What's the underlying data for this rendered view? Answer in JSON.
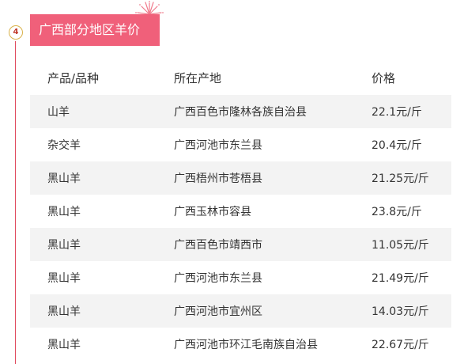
{
  "section": {
    "number": "4",
    "title": "广西部分地区羊价"
  },
  "colors": {
    "accent": "#f0607a",
    "timeline": "#e04b5f",
    "row_shade": "#f3f3f3"
  },
  "table": {
    "headers": [
      "产品/品种",
      "所在产地",
      "价格"
    ],
    "rows": [
      [
        "山羊",
        "广西百色市隆林各族自治县",
        "22.1元/斤"
      ],
      [
        "杂交羊",
        "广西河池市东兰县",
        "20.4元/斤"
      ],
      [
        "黑山羊",
        "广西梧州市苍梧县",
        "21.25元/斤"
      ],
      [
        "黑山羊",
        "广西玉林市容县",
        "23.8元/斤"
      ],
      [
        "黑山羊",
        "广西百色市靖西市",
        "11.05元/斤"
      ],
      [
        "黑山羊",
        "广西河池市东兰县",
        "21.49元/斤"
      ],
      [
        "黑山羊",
        "广西河池市宜州区",
        "14.03元/斤"
      ],
      [
        "黑山羊",
        "广西河池市环江毛南族自治县",
        "22.67元/斤"
      ]
    ]
  }
}
